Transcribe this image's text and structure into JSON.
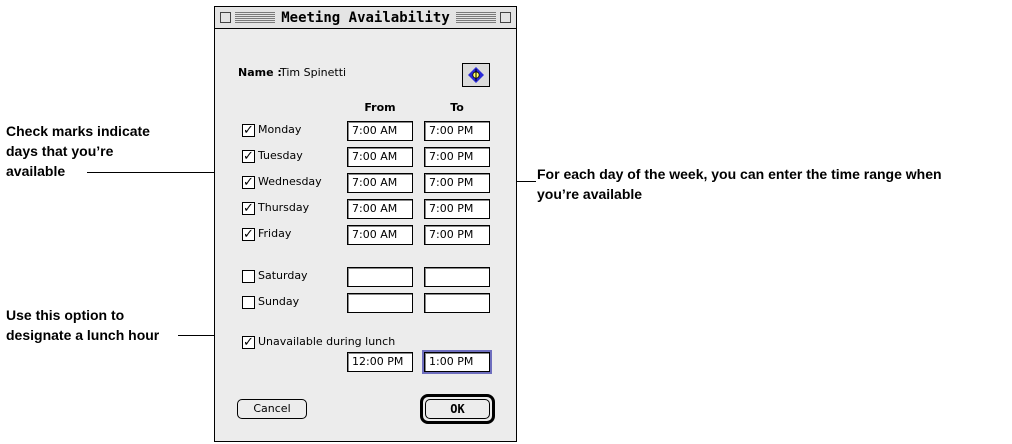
{
  "window": {
    "title": "Meeting Availability"
  },
  "name": {
    "label": "Name :",
    "value": "Tim Spinetti"
  },
  "columns": {
    "from": "From",
    "to": "To"
  },
  "days": [
    {
      "label": "Monday",
      "checked": true,
      "from": "7:00 AM",
      "to": "7:00 PM"
    },
    {
      "label": "Tuesday",
      "checked": true,
      "from": "7:00 AM",
      "to": "7:00 PM"
    },
    {
      "label": "Wednesday",
      "checked": true,
      "from": "7:00 AM",
      "to": "7:00 PM"
    },
    {
      "label": "Thursday",
      "checked": true,
      "from": "7:00 AM",
      "to": "7:00 PM"
    },
    {
      "label": "Friday",
      "checked": true,
      "from": "7:00 AM",
      "to": "7:00 PM"
    },
    {
      "label": "Saturday",
      "checked": false,
      "from": "",
      "to": ""
    },
    {
      "label": "Sunday",
      "checked": false,
      "from": "",
      "to": ""
    }
  ],
  "lunch": {
    "label": "Unavailable during lunch",
    "checked": true,
    "from": "12:00 PM",
    "to": "1:00 PM"
  },
  "buttons": {
    "cancel": "Cancel",
    "ok": "OK"
  },
  "check_mark": "✓",
  "callouts": {
    "checks": [
      "Check marks indicate",
      "days that you’re",
      "available"
    ],
    "lunch": [
      "Use this option to",
      "designate a lunch hour"
    ],
    "range": [
      "For each day of the week, you can enter the time range when",
      "you’re available"
    ]
  },
  "icons": {
    "info": "info-compass-icon"
  },
  "colors": {
    "focus_ring": "#6e6ebe",
    "icon_blue": "#2a2ad8"
  }
}
